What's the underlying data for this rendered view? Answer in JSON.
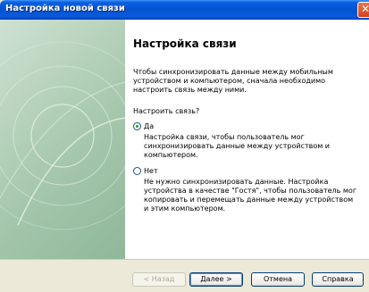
{
  "window": {
    "title": "Настройка новой связи"
  },
  "page": {
    "heading": "Настройка связи",
    "description": "Чтобы синхронизировать данные между мобильным устройством и компьютером, сначала необходимо настроить связь между ними.",
    "question": "Настроить связь?"
  },
  "options": {
    "yes": {
      "label": "Да",
      "description": "Настройка связи, чтобы пользователь мог синхронизировать данные между устройством и компьютером.",
      "checked": true
    },
    "no": {
      "label": "Нет",
      "description": "Не нужно синхронизировать данные. Настройка устройства в качестве \"Гостя\", чтобы пользователь мог копировать и перемещать данные между устройством и этим компьютером.",
      "checked": false
    }
  },
  "buttons": {
    "back": "< Назад",
    "next": "Далее >",
    "cancel": "Отмена",
    "help": "Справка"
  },
  "colors": {
    "titlebar": "#0453d4",
    "panel": "#a6c8ad",
    "radio_check": "#21a121"
  }
}
